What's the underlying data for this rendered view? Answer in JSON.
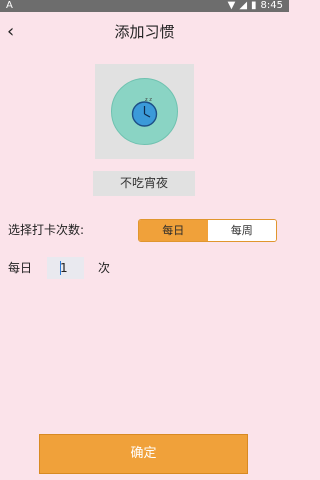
{
  "status_bar": {
    "left_icon": "A",
    "time": "8:45",
    "icons": [
      "wifi-icon",
      "signal-icon",
      "battery-icon"
    ]
  },
  "header": {
    "back_icon": "back-chevron-icon",
    "title": "添加习惯"
  },
  "habit": {
    "icon": "clock-night-icon",
    "name": "不吃宵夜"
  },
  "frequency": {
    "label": "选择打卡次数:",
    "options": [
      "每日",
      "每周"
    ],
    "selected": "每日"
  },
  "daily_count": {
    "prefix": "每日",
    "value": "1",
    "suffix": "次"
  },
  "confirm": {
    "label": "确定"
  },
  "colors": {
    "background": "#fbe3ea",
    "accent": "#f0a13a",
    "card": "#e1e1e1",
    "clock_outer": "#8ad4c4",
    "clock_inner": "#3b9ad9"
  }
}
